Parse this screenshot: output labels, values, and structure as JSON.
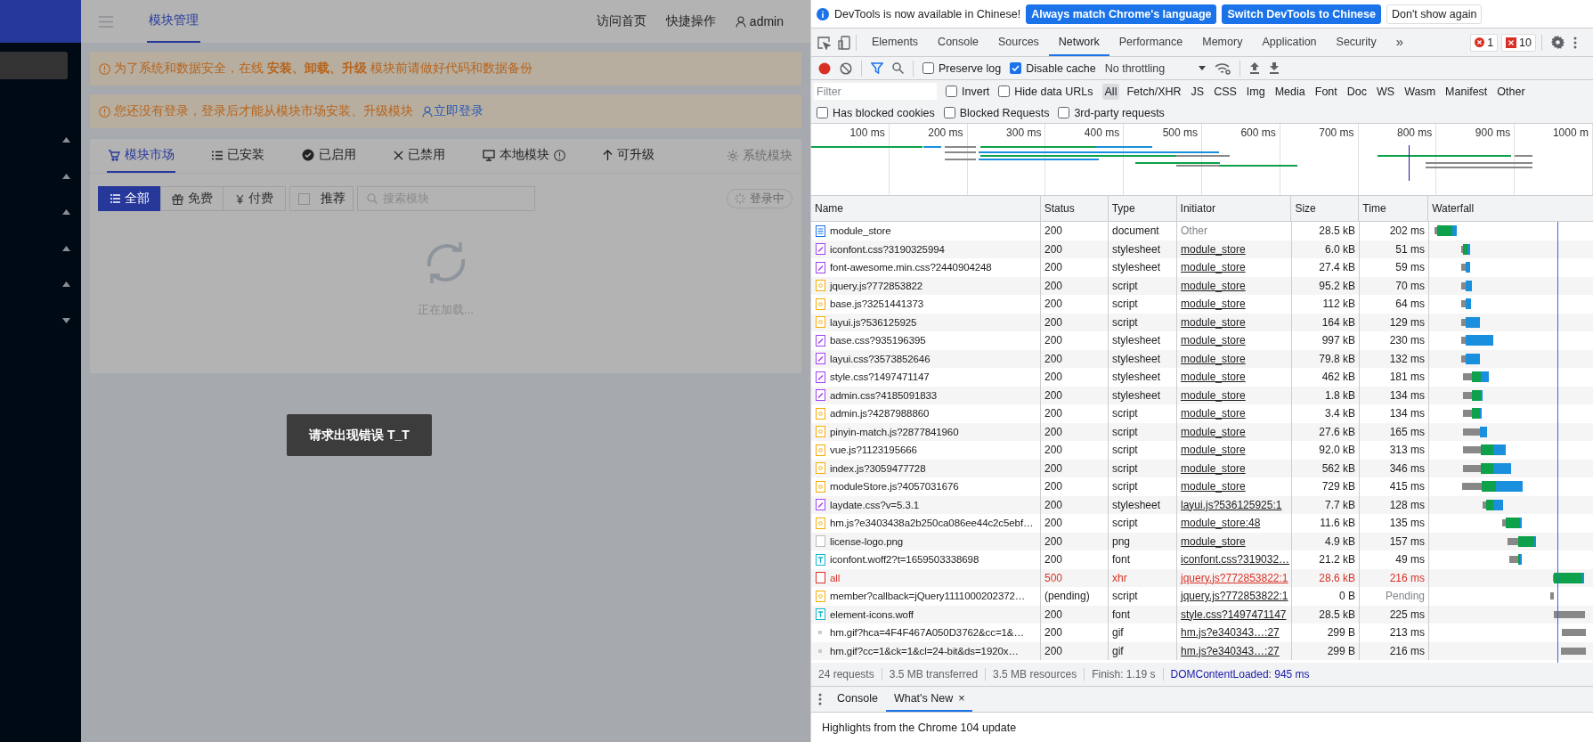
{
  "app": {
    "header": {
      "title": "模块管理",
      "links": [
        "访问首页",
        "快捷操作"
      ],
      "user": "admin"
    },
    "sidebar": {
      "items": [
        {
          "expanded": true
        },
        {
          "expanded": true
        },
        {
          "expanded": true
        },
        {
          "expanded": true
        },
        {
          "expanded": true
        },
        {
          "expanded": false
        }
      ]
    },
    "alerts": [
      {
        "text": "为了系统和数据安全，在线 **安装、卸载、升级** 模块前请做好代码和数据备份"
      },
      {
        "text": "您还没有登录，登录后才能从模块市场安装、升级模块",
        "link": "立即登录"
      }
    ],
    "tabs": [
      {
        "kind": "market",
        "label": "模块市场",
        "selected": true
      },
      {
        "kind": "installed",
        "label": "已安装",
        "selected": false
      },
      {
        "kind": "enabled",
        "label": "已启用",
        "selected": false
      },
      {
        "kind": "disabled",
        "label": "已禁用",
        "selected": false
      },
      {
        "kind": "local",
        "label": "本地模块",
        "selected": false
      },
      {
        "kind": "upgradable",
        "label": "可升级",
        "selected": false
      }
    ],
    "system_tab": {
      "label": "系统模块",
      "disabled": true
    },
    "filters": [
      {
        "kind": "all",
        "label": "全部",
        "selected": true
      },
      {
        "kind": "free",
        "label": "免费",
        "selected": false
      },
      {
        "kind": "paid",
        "label": "付费",
        "selected": false
      }
    ],
    "recommend": {
      "label": "推荐",
      "checked": false
    },
    "search": {
      "placeholder": "搜索模块"
    },
    "login_button": "登录中",
    "loading_text": "正在加载...",
    "toast": "请求出现错误 T_T"
  },
  "devtools": {
    "infobar": {
      "text": "DevTools is now available in Chinese!",
      "buttons": [
        {
          "label": "Always match Chrome's language",
          "primary": true
        },
        {
          "label": "Switch DevTools to Chinese",
          "primary": true
        },
        {
          "label": "Don't show again",
          "primary": false
        }
      ]
    },
    "panel_tabs": [
      {
        "label": "Elements",
        "selected": false
      },
      {
        "label": "Console",
        "selected": false
      },
      {
        "label": "Sources",
        "selected": false
      },
      {
        "label": "Network",
        "selected": true
      },
      {
        "label": "Performance",
        "selected": false
      },
      {
        "label": "Memory",
        "selected": false
      },
      {
        "label": "Application",
        "selected": false
      },
      {
        "label": "Security",
        "selected": false
      }
    ],
    "more_tabs": "»",
    "errors": "1",
    "issues": "10",
    "toolbar": {
      "recording": true,
      "options": [
        {
          "label": "Preserve log",
          "checked": false
        },
        {
          "label": "Disable cache",
          "checked": true
        }
      ],
      "throttling": "No throttling"
    },
    "filter": {
      "placeholder": "Filter",
      "options": [
        {
          "label": "Invert",
          "checked": false
        },
        {
          "label": "Hide data URLs",
          "checked": false
        }
      ],
      "types": [
        {
          "label": "All",
          "selected": true
        },
        {
          "label": "Fetch/XHR",
          "selected": false
        },
        {
          "label": "JS",
          "selected": false
        },
        {
          "label": "CSS",
          "selected": false
        },
        {
          "label": "Img",
          "selected": false
        },
        {
          "label": "Media",
          "selected": false
        },
        {
          "label": "Font",
          "selected": false
        },
        {
          "label": "Doc",
          "selected": false
        },
        {
          "label": "WS",
          "selected": false
        },
        {
          "label": "Wasm",
          "selected": false
        },
        {
          "label": "Manifest",
          "selected": false
        },
        {
          "label": "Other",
          "selected": false
        }
      ]
    },
    "extra_filters": [
      {
        "label": "Has blocked cookies",
        "checked": false
      },
      {
        "label": "Blocked Requests",
        "checked": false
      },
      {
        "label": "3rd-party requests",
        "checked": false
      }
    ],
    "overview": {
      "ticks": [
        "100 ms",
        "200 ms",
        "300 ms",
        "400 ms",
        "500 ms",
        "600 ms",
        "700 ms",
        "800 ms",
        "900 ms",
        "1000 m"
      ]
    },
    "columns": [
      "Name",
      "Status",
      "Type",
      "Initiator",
      "Size",
      "Time",
      "Waterfall"
    ],
    "rows": [
      {
        "kind": "document",
        "name": "module_store",
        "status": "200",
        "type": "document",
        "initiator": "Other",
        "linked": false,
        "size": "28.5 kB",
        "time": "202 ms",
        "failed": false
      },
      {
        "kind": "stylesheet",
        "name": "iconfont.css?3190325994",
        "status": "200",
        "type": "stylesheet",
        "initiator": "module_store",
        "linked": true,
        "size": "6.0 kB",
        "time": "51 ms",
        "failed": false
      },
      {
        "kind": "stylesheet",
        "name": "font-awesome.min.css?2440904248",
        "status": "200",
        "type": "stylesheet",
        "initiator": "module_store",
        "linked": true,
        "size": "27.4 kB",
        "time": "59 ms",
        "failed": false
      },
      {
        "kind": "script",
        "name": "jquery.js?772853822",
        "status": "200",
        "type": "script",
        "initiator": "module_store",
        "linked": true,
        "size": "95.2 kB",
        "time": "70 ms",
        "failed": false
      },
      {
        "kind": "script",
        "name": "base.js?3251441373",
        "status": "200",
        "type": "script",
        "initiator": "module_store",
        "linked": true,
        "size": "112 kB",
        "time": "64 ms",
        "failed": false
      },
      {
        "kind": "script",
        "name": "layui.js?536125925",
        "status": "200",
        "type": "script",
        "initiator": "module_store",
        "linked": true,
        "size": "164 kB",
        "time": "129 ms",
        "failed": false
      },
      {
        "kind": "stylesheet",
        "name": "base.css?935196395",
        "status": "200",
        "type": "stylesheet",
        "initiator": "module_store",
        "linked": true,
        "size": "997 kB",
        "time": "230 ms",
        "failed": false
      },
      {
        "kind": "stylesheet",
        "name": "layui.css?3573852646",
        "status": "200",
        "type": "stylesheet",
        "initiator": "module_store",
        "linked": true,
        "size": "79.8 kB",
        "time": "132 ms",
        "failed": false
      },
      {
        "kind": "stylesheet",
        "name": "style.css?1497471147",
        "status": "200",
        "type": "stylesheet",
        "initiator": "module_store",
        "linked": true,
        "size": "462 kB",
        "time": "181 ms",
        "failed": false
      },
      {
        "kind": "stylesheet",
        "name": "admin.css?4185091833",
        "status": "200",
        "type": "stylesheet",
        "initiator": "module_store",
        "linked": true,
        "size": "1.8 kB",
        "time": "134 ms",
        "failed": false
      },
      {
        "kind": "script",
        "name": "admin.js?4287988860",
        "status": "200",
        "type": "script",
        "initiator": "module_store",
        "linked": true,
        "size": "3.4 kB",
        "time": "134 ms",
        "failed": false
      },
      {
        "kind": "script",
        "name": "pinyin-match.js?2877841960",
        "status": "200",
        "type": "script",
        "initiator": "module_store",
        "linked": true,
        "size": "27.6 kB",
        "time": "165 ms",
        "failed": false
      },
      {
        "kind": "script",
        "name": "vue.js?1123195666",
        "status": "200",
        "type": "script",
        "initiator": "module_store",
        "linked": true,
        "size": "92.0 kB",
        "time": "313 ms",
        "failed": false
      },
      {
        "kind": "script",
        "name": "index.js?3059477728",
        "status": "200",
        "type": "script",
        "initiator": "module_store",
        "linked": true,
        "size": "562 kB",
        "time": "346 ms",
        "failed": false
      },
      {
        "kind": "script",
        "name": "moduleStore.js?4057031676",
        "status": "200",
        "type": "script",
        "initiator": "module_store",
        "linked": true,
        "size": "729 kB",
        "time": "415 ms",
        "failed": false
      },
      {
        "kind": "stylesheet",
        "name": "laydate.css?v=5.3.1",
        "status": "200",
        "type": "stylesheet",
        "initiator": "layui.js?536125925:1",
        "linked": true,
        "size": "7.7 kB",
        "time": "128 ms",
        "failed": false
      },
      {
        "kind": "script",
        "name": "hm.js?e3403438a2b250ca086ee44c2c5ebf…",
        "status": "200",
        "type": "script",
        "initiator": "module_store:48",
        "linked": true,
        "size": "11.6 kB",
        "time": "135 ms",
        "failed": false
      },
      {
        "kind": "image",
        "name": "license-logo.png",
        "status": "200",
        "type": "png",
        "initiator": "module_store",
        "linked": true,
        "size": "4.9 kB",
        "time": "157 ms",
        "failed": false
      },
      {
        "kind": "font",
        "name": "iconfont.woff2?t=1659503338698",
        "status": "200",
        "type": "font",
        "initiator": "iconfont.css?319032…",
        "linked": true,
        "size": "21.2 kB",
        "time": "49 ms",
        "failed": false
      },
      {
        "kind": "xhr",
        "name": "all",
        "status": "500",
        "type": "xhr",
        "initiator": "jquery.js?772853822:1",
        "linked": true,
        "size": "28.6 kB",
        "time": "216 ms",
        "failed": true
      },
      {
        "kind": "script",
        "name": "member?callback=jQuery1111000202372…",
        "status": "(pending)",
        "type": "script",
        "initiator": "jquery.js?772853822:1",
        "linked": true,
        "size": "0 B",
        "time": "Pending",
        "failed": false
      },
      {
        "kind": "font",
        "name": "element-icons.woff",
        "status": "200",
        "type": "font",
        "initiator": "style.css?1497471147",
        "linked": true,
        "size": "28.5 kB",
        "time": "225 ms",
        "failed": false
      },
      {
        "kind": "gif",
        "name": "hm.gif?hca=4F4F467A050D3762&cc=1&…",
        "status": "200",
        "type": "gif",
        "initiator": "hm.js?e340343…:27",
        "linked": true,
        "size": "299 B",
        "time": "213 ms",
        "failed": false
      },
      {
        "kind": "gif",
        "name": "hm.gif?cc=1&ck=1&cl=24-bit&ds=1920x…",
        "status": "200",
        "type": "gif",
        "initiator": "hm.js?e340343…:27",
        "linked": true,
        "size": "299 B",
        "time": "216 ms",
        "failed": false
      }
    ],
    "summary": [
      "24 requests",
      "3.5 MB transferred",
      "3.5 MB resources",
      "Finish: 1.19 s",
      "DOMContentLoaded: 945 ms"
    ],
    "drawer": {
      "tabs": [
        {
          "label": "Console",
          "selected": false
        },
        {
          "label": "What's New",
          "selected": true,
          "close": "×"
        }
      ],
      "content": "Highlights from the Chrome 104 update"
    }
  }
}
